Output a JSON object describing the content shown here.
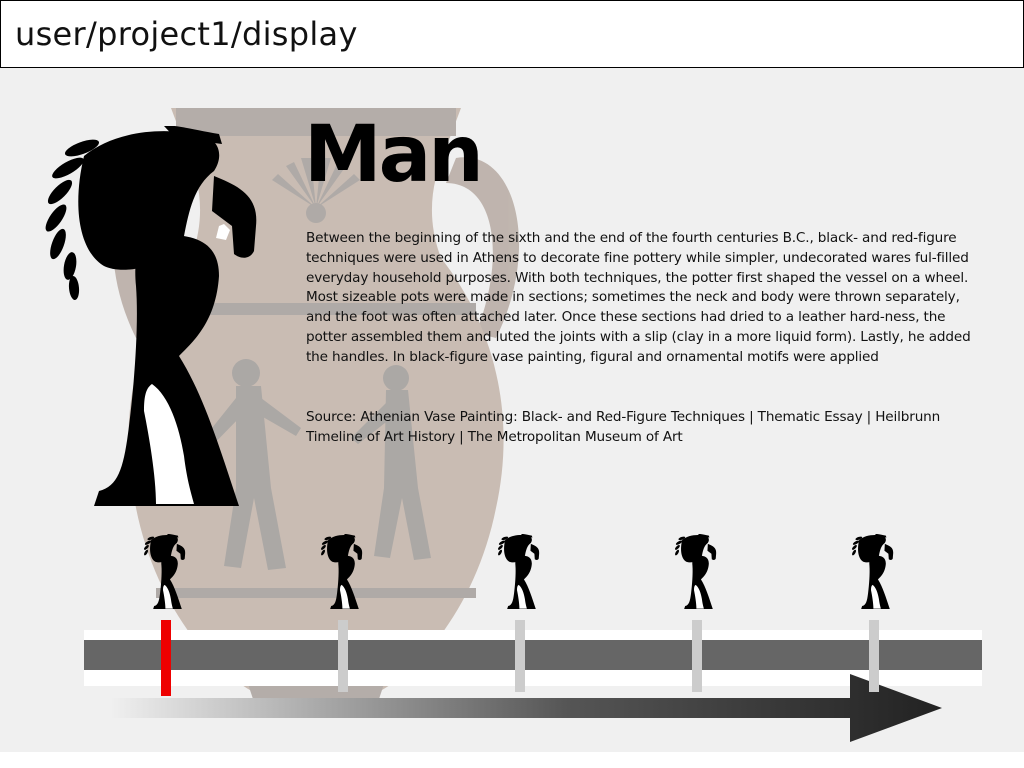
{
  "address_bar": {
    "path": "user/project1/display"
  },
  "content": {
    "title": "Man",
    "paragraph": "Between the beginning of the sixth and the end of the fourth centuries B.C., black- and red-figure techniques were used in Athens to decorate fine pottery while simpler, undecorated wares ful-filled everyday household purposes. With both techniques, the potter first shaped the vessel on a wheel. Most sizeable pots were made in sections; sometimes the neck and body were thrown separately, and the foot was often attached later. Once these sections had dried to a leather hard-ness, the potter assembled them and luted the joints with a slip (clay in a more liquid form). Lastly, he added the handles. In black-figure vase painting, figural and ornamental motifs were applied",
    "source": "Source: Athenian Vase Painting: Black- and Red-Figure Techniques | Thematic Essay | Heilbrunn Timeline of Art History | The Metropolitan Museum of Art"
  },
  "timeline": {
    "marker_count": 5,
    "active_index": 0,
    "active_color": "#ee0000",
    "inactive_color": "#cccccc",
    "track_color": "#666666"
  },
  "icons": {
    "hero": "figure-carrying-branch-icon",
    "marker": "figure-carrying-branch-icon",
    "arrow": "arrow-right-icon"
  }
}
